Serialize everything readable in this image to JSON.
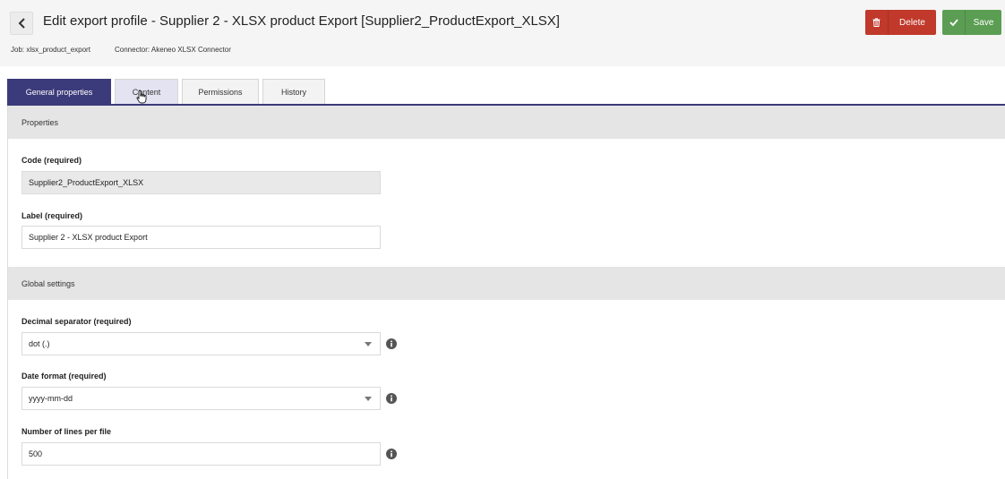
{
  "header": {
    "title": "Edit export profile - Supplier 2 - XLSX product Export [Supplier2_ProductExport_XLSX]",
    "job": "Job: xlsx_product_export",
    "connector": "Connector: Akeneo XLSX Connector",
    "back_icon": "chevron-left-icon",
    "delete_label": "Delete",
    "save_label": "Save",
    "delete_color": "#c0392b",
    "save_color": "#5b9d53"
  },
  "tabs": [
    {
      "label": "General properties",
      "active": true
    },
    {
      "label": "Content",
      "active": false
    },
    {
      "label": "Permissions",
      "active": false
    },
    {
      "label": "History",
      "active": false
    }
  ],
  "properties": {
    "section_title": "Properties",
    "code_label": "Code (required)",
    "code_value": "Supplier2_ProductExport_XLSX",
    "label_label": "Label (required)",
    "label_value": "Supplier 2 - XLSX product Export"
  },
  "global_settings": {
    "section_title": "Global settings",
    "decimal_label": "Decimal separator (required)",
    "decimal_value": "dot (.)",
    "date_label": "Date format (required)",
    "date_value": "yyyy-mm-dd",
    "lines_label": "Number of lines per file",
    "lines_value": "500"
  },
  "colors": {
    "accent": "#3b3a7a",
    "section_bg": "#e5e5e5"
  }
}
